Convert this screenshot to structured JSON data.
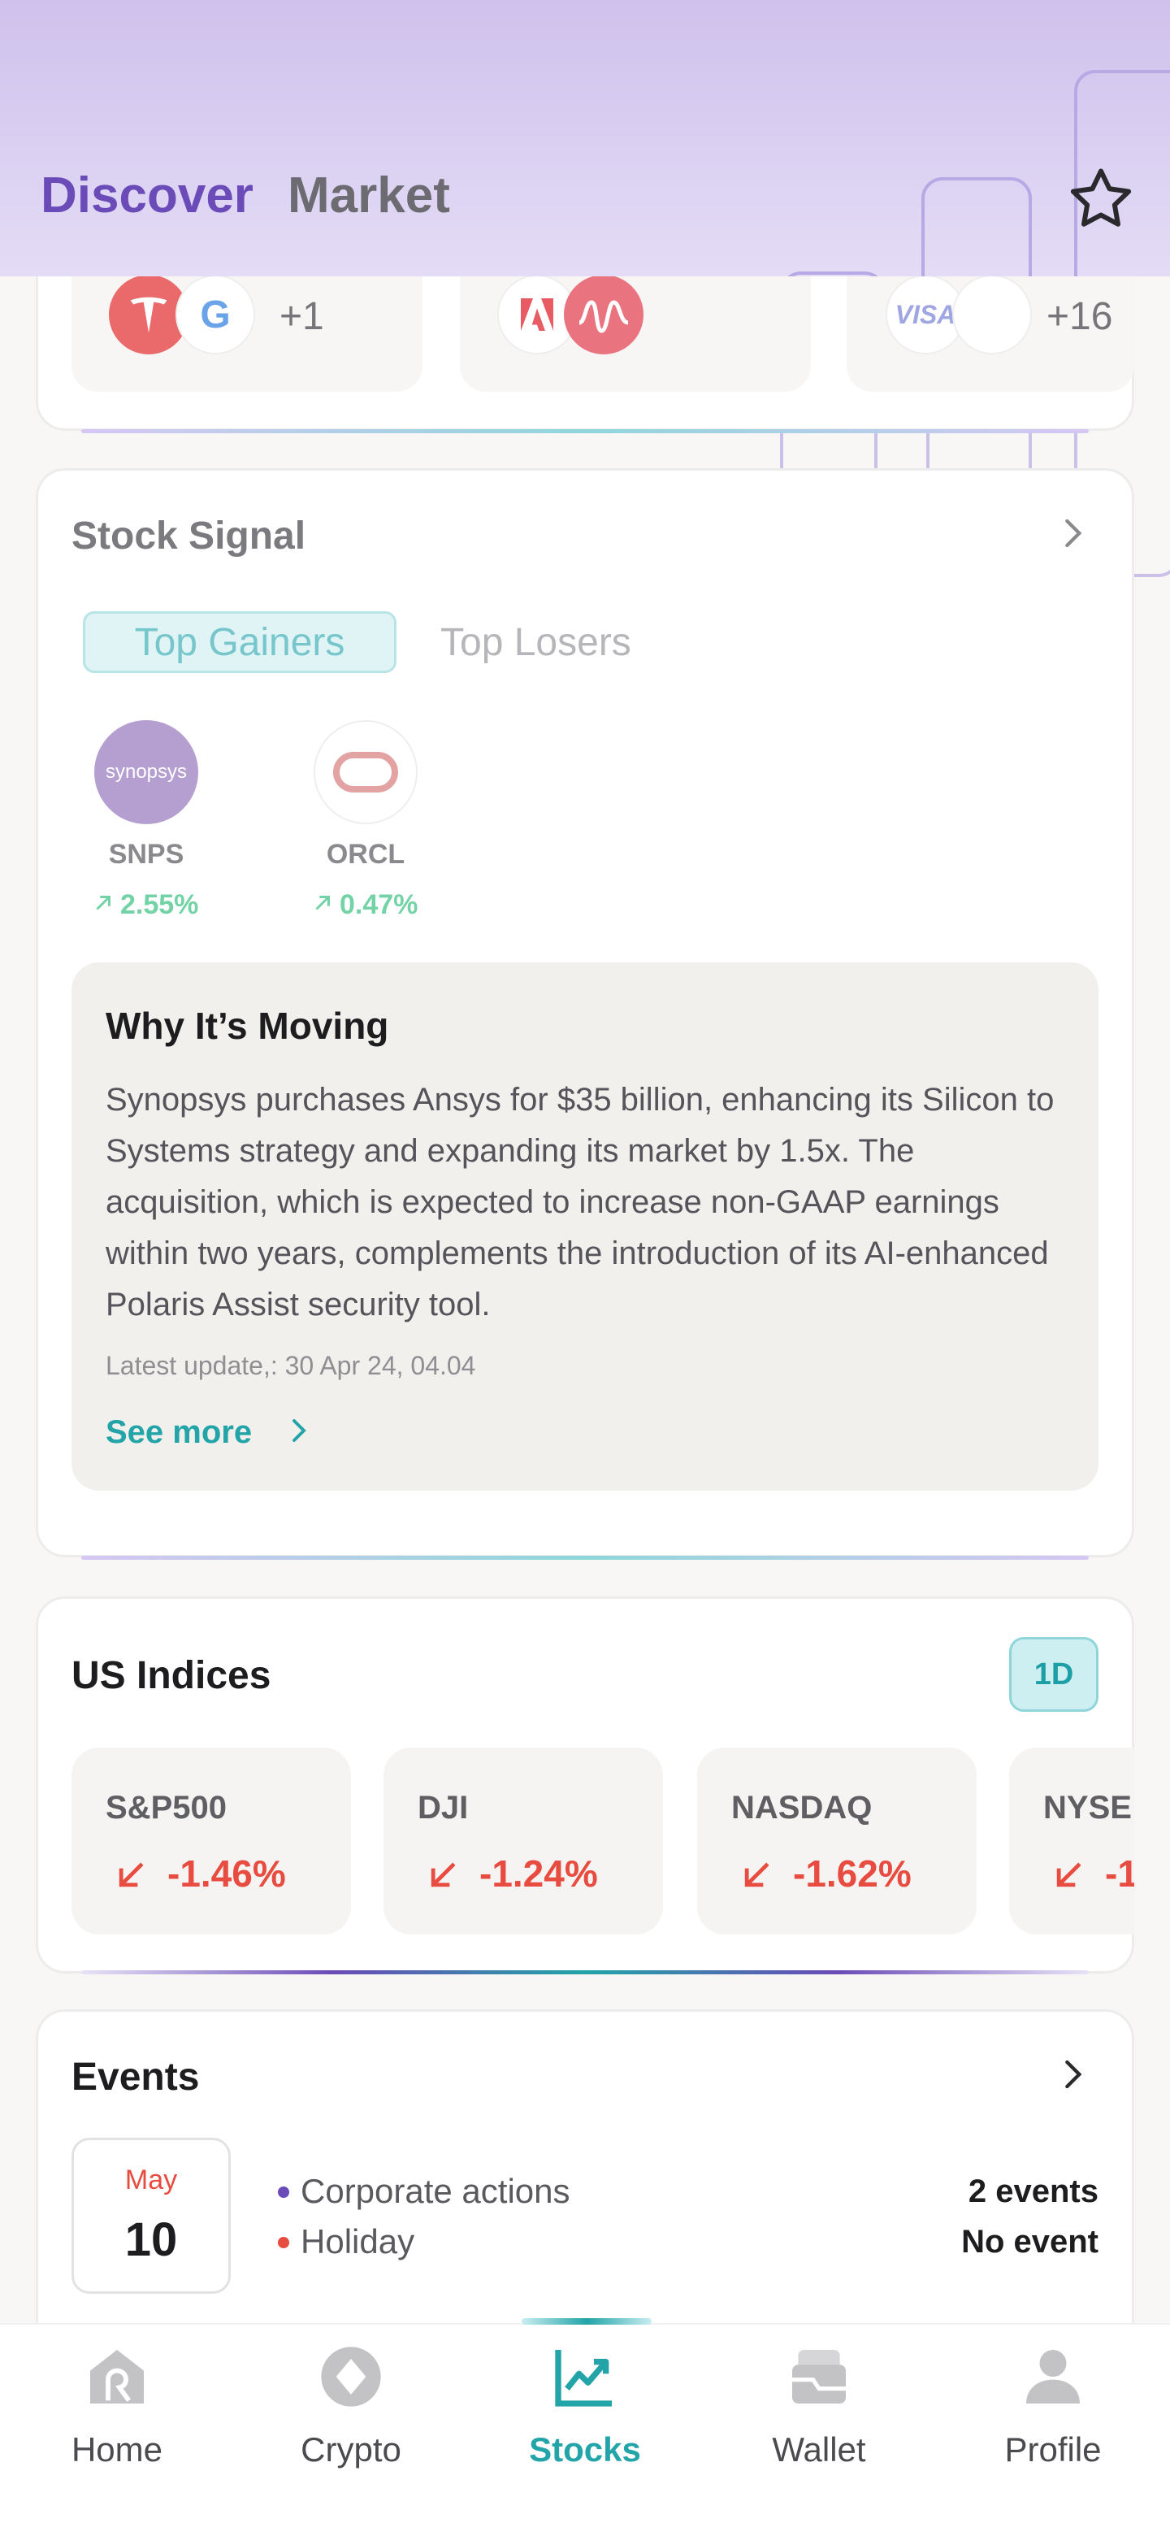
{
  "header": {
    "tabs": [
      {
        "label": "Discover",
        "active": true
      },
      {
        "label": "Market",
        "active": false
      }
    ]
  },
  "themes": {
    "tiles": [
      {
        "logos": [
          "tesla-logo",
          "google-logo"
        ],
        "more": "+1"
      },
      {
        "logos": [
          "adobe-logo",
          "pulse-logo"
        ],
        "more": ""
      },
      {
        "logos": [
          "visa-logo",
          "blank-logo"
        ],
        "more": "+16"
      }
    ],
    "visa_text": "VISA"
  },
  "stock_signal": {
    "title": "Stock Signal",
    "tabs": [
      "Top Gainers",
      "Top Losers"
    ],
    "stocks": [
      {
        "ticker": "SNPS",
        "logo_text": "synopsys",
        "change": "2.55%"
      },
      {
        "ticker": "ORCL",
        "logo_text": "",
        "change": "0.47%"
      }
    ],
    "why_moving": {
      "title": "Why It’s Moving",
      "body": "Synopsys purchases Ansys for $35 billion, enhancing its Silicon to Systems strategy and expanding its market by 1.5x. The acquisition, which is expected to increase non-GAAP earnings within two years, complements the introduction of its AI-enhanced Polaris Assist security tool.",
      "update": "Latest update,: 30 Apr 24, 04.04",
      "see_more": "See more"
    }
  },
  "us_indices": {
    "title": "US Indices",
    "timeframe": "1D",
    "items": [
      {
        "name": "S&P500",
        "change": "-1.46%"
      },
      {
        "name": "DJI",
        "change": "-1.24%"
      },
      {
        "name": "NASDAQ",
        "change": "-1.62%"
      },
      {
        "name": "NYSE",
        "change": "-1"
      }
    ]
  },
  "events": {
    "title": "Events",
    "month": "May",
    "day": "10",
    "rows": [
      {
        "label": "Corporate actions",
        "count": "2 events",
        "dot_color": "#6a4bb7"
      },
      {
        "label": "Holiday",
        "count": "No event",
        "dot_color": "#e84b3f"
      }
    ]
  },
  "colors": {
    "accent": "#22a4a8",
    "brand_purple": "#6a4bb7",
    "gain": "#73d3a6",
    "loss": "#e84b3f"
  },
  "nav": {
    "items": [
      {
        "label": "Home",
        "icon": "home-icon",
        "active": false
      },
      {
        "label": "Crypto",
        "icon": "crypto-icon",
        "active": false
      },
      {
        "label": "Stocks",
        "icon": "stocks-icon",
        "active": true
      },
      {
        "label": "Wallet",
        "icon": "wallet-icon",
        "active": false
      },
      {
        "label": "Profile",
        "icon": "profile-icon",
        "active": false
      }
    ]
  }
}
